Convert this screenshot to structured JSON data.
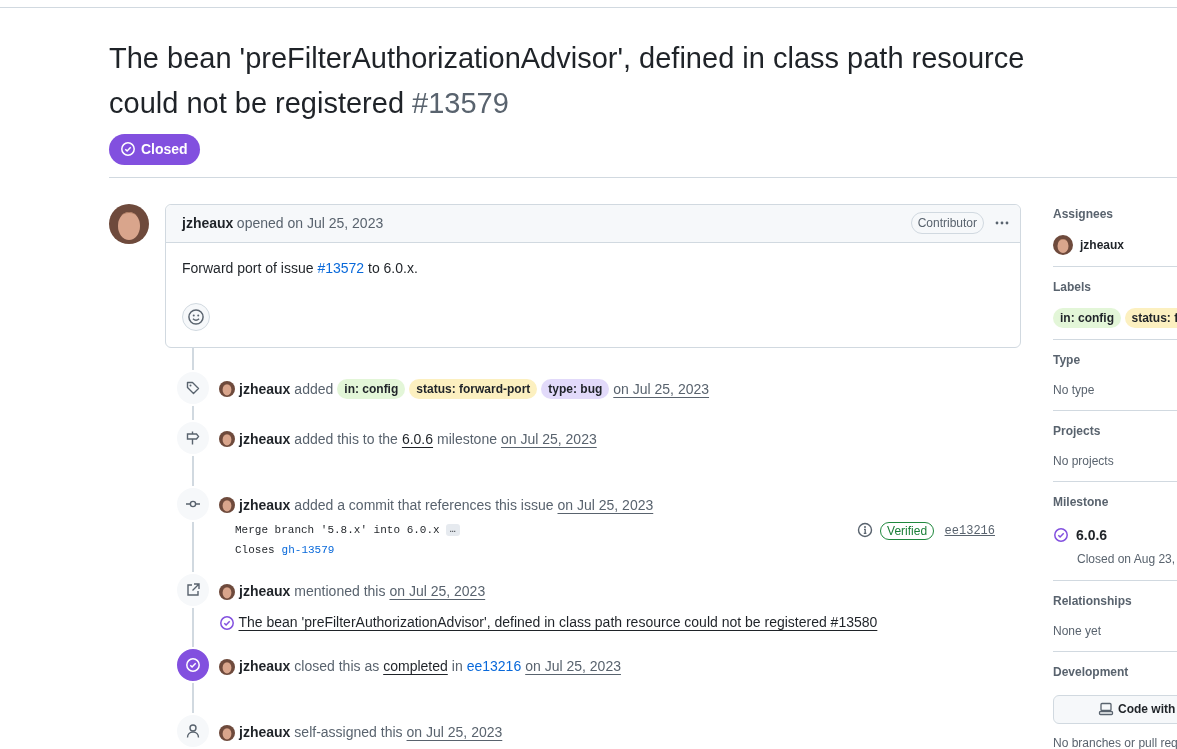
{
  "issue": {
    "title": "The bean 'preFilterAuthorizationAdvisor', defined in class path resource could not be registered",
    "number": "#13579",
    "status": {
      "kind": "closed",
      "label": "Closed"
    }
  },
  "comment": {
    "author": "jzheaux",
    "action": "opened on Jul 25, 2023",
    "role": "Contributor",
    "body_before": "Forward port of issue",
    "body_link": "#13572",
    "body_after": "to 6.0.x."
  },
  "events": [
    {
      "kind": "labeled",
      "actor": "jzheaux",
      "parts": [
        {
          "kind": "text",
          "text": "added"
        },
        {
          "kind": "label",
          "text": "in: config",
          "color": "#e3f6d8"
        },
        {
          "kind": "label",
          "text": "status: forward-port",
          "color": "#fcf0c0"
        },
        {
          "kind": "label",
          "text": "type: bug",
          "color": "#e2dafa"
        },
        {
          "kind": "time",
          "text": "on Jul 25, 2023"
        }
      ]
    },
    {
      "kind": "milestoned",
      "actor": "jzheaux",
      "parts": [
        {
          "kind": "text",
          "text": "added this to the"
        },
        {
          "kind": "link",
          "text": "6.0.6"
        },
        {
          "kind": "text",
          "text": "milestone"
        },
        {
          "kind": "time",
          "text": "on Jul 25, 2023"
        }
      ]
    },
    {
      "kind": "committed",
      "actor": "jzheaux",
      "parts": [
        {
          "kind": "text",
          "text": "added a commit that references this issue"
        },
        {
          "kind": "time",
          "text": "on Jul 25, 2023"
        }
      ],
      "commit": {
        "message": "Merge branch '5.8.x' into 6.0.x",
        "more": "…",
        "closes": "Closes",
        "ref": "gh-13579",
        "verified": "Verified",
        "sha": "ee13216"
      }
    },
    {
      "kind": "mentioned",
      "actor": "jzheaux",
      "parts": [
        {
          "kind": "text",
          "text": "mentioned this"
        },
        {
          "kind": "time",
          "text": "on Jul 25, 2023"
        }
      ],
      "mention": {
        "text": "The bean 'preFilterAuthorizationAdvisor', defined in class path resource could not be registered #13580"
      }
    },
    {
      "kind": "closed",
      "actor": "jzheaux",
      "parts": [
        {
          "kind": "text",
          "text": "closed this as"
        },
        {
          "kind": "link",
          "text": "completed"
        },
        {
          "kind": "text",
          "text": "in"
        },
        {
          "kind": "commit",
          "text": "ee13216"
        },
        {
          "kind": "time",
          "text": "on Jul 25, 2023"
        }
      ]
    },
    {
      "kind": "assigned",
      "actor": "jzheaux",
      "parts": [
        {
          "kind": "text",
          "text": "self-assigned this"
        },
        {
          "kind": "time",
          "text": "on Jul 25, 2023"
        }
      ]
    }
  ],
  "sidebar": {
    "sections": [
      {
        "kind": "assignees",
        "title": "Assignees",
        "users": [
          "jzheaux"
        ]
      },
      {
        "kind": "labels",
        "title": "Labels",
        "labels": [
          {
            "text": "in: config",
            "color": "#e3f6d8"
          },
          {
            "text": "status: f",
            "color": "#fcf0c0"
          }
        ]
      },
      {
        "kind": "text",
        "title": "Type",
        "text": "No type"
      },
      {
        "kind": "text",
        "title": "Projects",
        "text": "No projects"
      },
      {
        "kind": "milestone",
        "title": "Milestone",
        "name": "6.0.6",
        "note": "Closed on Aug 23,"
      },
      {
        "kind": "text",
        "title": "Relationships",
        "text": "None yet"
      },
      {
        "kind": "development",
        "title": "Development",
        "button": "Code with",
        "text": "No branches or pull req"
      }
    ]
  }
}
